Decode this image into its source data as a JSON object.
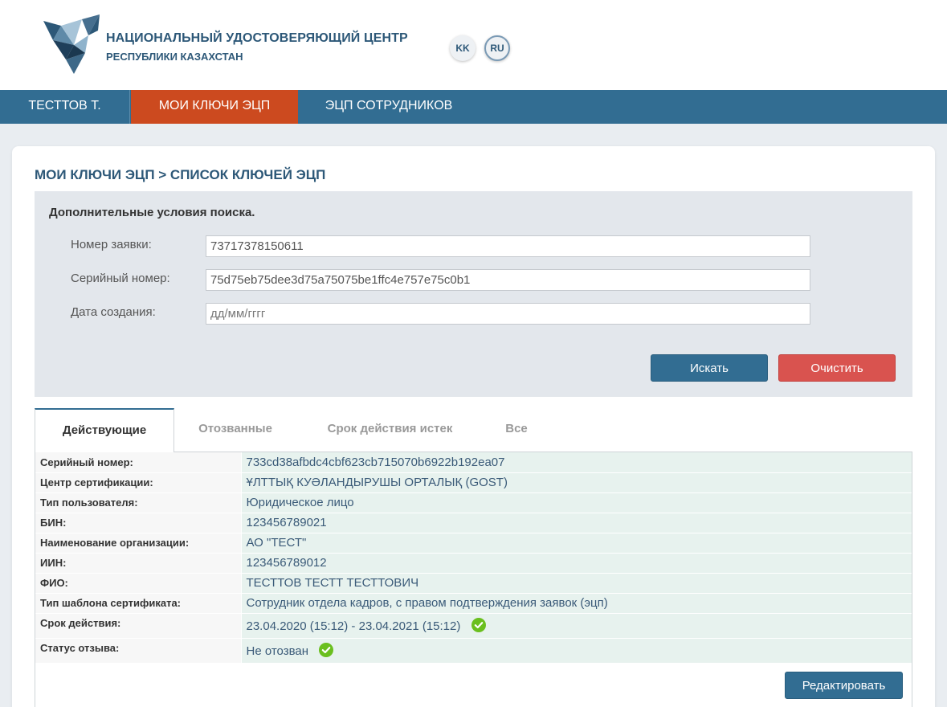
{
  "brand": {
    "title": "НАЦИОНАЛЬНЫЙ УДОСТОВЕРЯЮЩИЙ ЦЕНТР",
    "subtitle": "РЕСПУБЛИКИ КАЗАХСТАН"
  },
  "languages": [
    "KK",
    "RU"
  ],
  "nav": {
    "user": "ТЕСТТОВ Т.",
    "my_keys": "МОИ КЛЮЧИ ЭЦП",
    "staff_keys": "ЭЦП СОТРУДНИКОВ"
  },
  "page_title": "МОИ КЛЮЧИ ЭЦП > СПИСОК КЛЮЧЕЙ ЭЦП",
  "search": {
    "heading": "Дополнительные условия поиска.",
    "request_label": "Номер заявки:",
    "request_value": "73717378150611",
    "serial_label": "Серийный номер:",
    "serial_value": "75d75eb75dee3d75a75075be1ffc4e757e75c0b1",
    "date_label": "Дата создания:",
    "date_placeholder": "дд/мм/гггг",
    "search_button": "Искать",
    "clear_button": "Очистить"
  },
  "tabs": {
    "active": "Действующие",
    "revoked": "Отозванные",
    "expired": "Срок действия истек",
    "all": "Все"
  },
  "record": {
    "serial_label": "Серийный номер:",
    "serial": "733cd38afbdc4cbf623cb715070b6922b192ea07",
    "ca_label": "Центр сертификации:",
    "ca": "ҰЛТТЫҚ КУӘЛАНДЫРУШЫ ОРТАЛЫҚ (GOST)",
    "user_type_label": "Тип пользователя:",
    "user_type": "Юридическое лицо",
    "bin_label": "БИН:",
    "bin": "123456789021",
    "org_label": "Наименование организации:",
    "org": "АО \"ТЕСТ\"",
    "iin_label": "ИИН:",
    "iin": "123456789012",
    "fio_label": "ФИО:",
    "fio": "ТЕСТТОВ ТЕСТТ ТЕСТТОВИЧ",
    "template_label": "Тип шаблона сертификата:",
    "template": "Сотрудник отдела кадров, с правом подтверждения заявок (эцп)",
    "validity_label": "Срок действия:",
    "validity": "23.04.2020 (15:12) - 23.04.2021 (15:12)",
    "revocation_label": "Статус отзыва:",
    "revocation": "Не отозван"
  },
  "edit_button": "Редактировать",
  "colors": {
    "nav": "#326d92",
    "nav_active": "#cc4a1f",
    "danger": "#d9534f",
    "ok": "#6abf1e"
  }
}
